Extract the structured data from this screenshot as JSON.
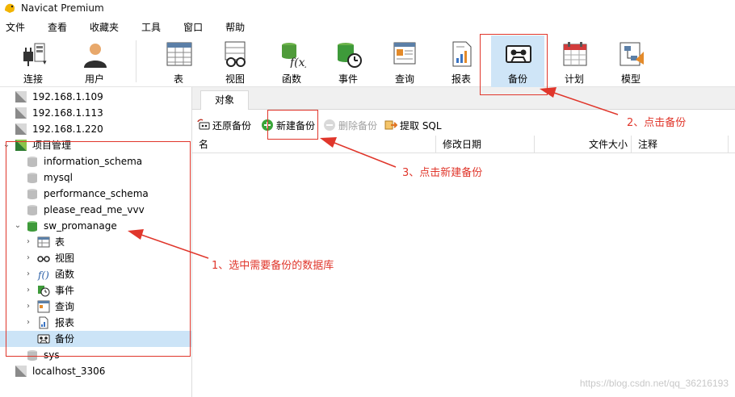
{
  "window": {
    "title": "Navicat Premium"
  },
  "menu": [
    "文件",
    "查看",
    "收藏夹",
    "工具",
    "窗口",
    "帮助"
  ],
  "toolbar": {
    "connect": "连接",
    "user": "用户",
    "table": "表",
    "view": "视图",
    "function": "函数",
    "event": "事件",
    "query": "查询",
    "report": "报表",
    "backup": "备份",
    "schedule": "计划",
    "model": "模型"
  },
  "tree": {
    "connections_top": [
      "192.168.1.109",
      "192.168.1.113",
      "192.168.1.220"
    ],
    "project": "项目管理",
    "databases": [
      "information_schema",
      "mysql",
      "performance_schema",
      "please_read_me_vvv",
      "sw_promanage"
    ],
    "children": [
      "表",
      "视图",
      "函数",
      "事件",
      "查询",
      "报表",
      "备份"
    ],
    "after": "sys",
    "bottom_connection": "localhost_3306"
  },
  "panel": {
    "tab": "对象",
    "actions": {
      "restore": "还原备份",
      "new_backup": "新建备份",
      "delete_backup": "删除备份",
      "extract_sql": "提取 SQL"
    },
    "columns": {
      "name": "名",
      "modified": "修改日期",
      "size": "文件大小",
      "comment": "注释"
    }
  },
  "annotations": {
    "step1": "1、选中需要备份的数据库",
    "step2": "2、点击备份",
    "step3": "3、点击新建备份",
    "color": "#e0362b"
  },
  "watermark": "https://blog.csdn.net/qq_36216193"
}
